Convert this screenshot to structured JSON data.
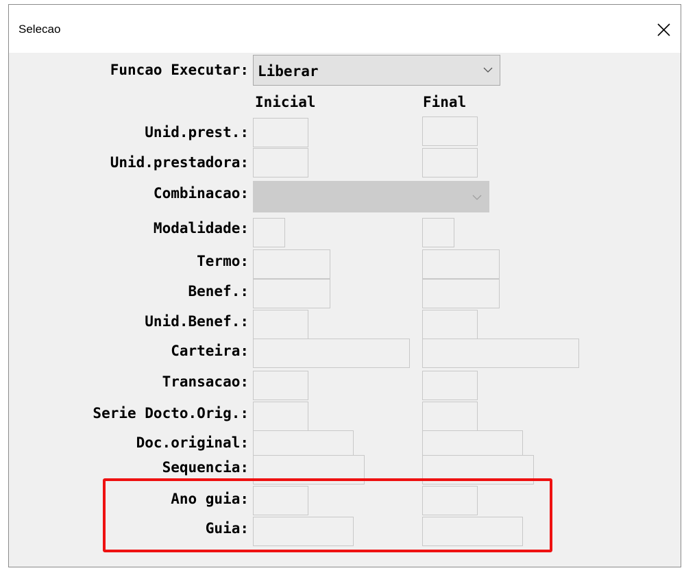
{
  "window": {
    "title": "Selecao"
  },
  "form": {
    "funcao_label": "Funcao Executar:",
    "funcao_value": "Liberar",
    "col_inicial": "Inicial",
    "col_final": "Final",
    "labels": {
      "unid_prest": "Unid.prest.:",
      "unid_prestadora": "Unid.prestadora:",
      "combinacao": "Combinacao:",
      "modalidade": "Modalidade:",
      "termo": "Termo:",
      "benef": "Benef.:",
      "unid_benef": "Unid.Benef.:",
      "carteira": "Carteira:",
      "transacao": "Transacao:",
      "serie": "Serie Docto.Orig.:",
      "doc_original": "Doc.original:",
      "sequencia": "Sequencia:",
      "ano_guia": "Ano guia:",
      "guia": "Guia:"
    }
  },
  "colors": {
    "highlight": "#ee1111",
    "window_bg": "#f0f0f0"
  },
  "icons": {
    "close": "close-icon",
    "dropdown": "chevron-down-icon"
  }
}
